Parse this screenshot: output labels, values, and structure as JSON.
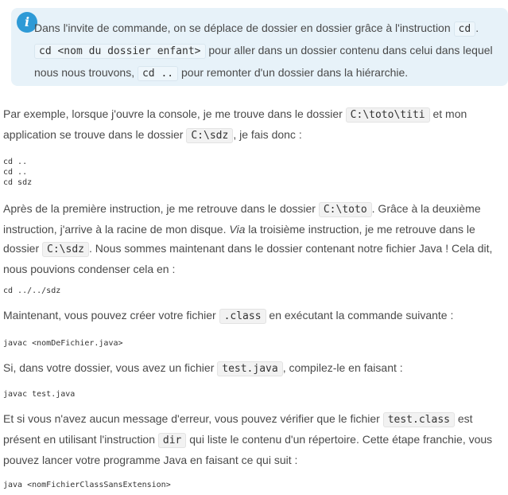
{
  "info": {
    "icon": "info-icon",
    "t1": "Dans l'invite de commande, on se déplace de dossier en dossier grâce à l'instruction ",
    "c1": "cd",
    "t2": ".",
    "c2": "cd <nom du dossier enfant>",
    "t3": " pour aller dans un dossier contenu dans celui dans lequel nous nous trouvons, ",
    "c3": "cd ..",
    "t4": " pour remonter d'un dossier dans la hiérarchie."
  },
  "p1": {
    "t1": "Par exemple, lorsque j'ouvre la console, je me trouve dans le dossier ",
    "c1": "C:\\toto\\titi",
    "t2": " et mon application se trouve dans le dossier ",
    "c2": "C:\\sdz",
    "t3": ", je fais donc :"
  },
  "code1": "cd ..\ncd ..\ncd sdz",
  "p2": {
    "t1": "Après de la première instruction, je me retrouve dans le dossier ",
    "c1": "C:\\toto",
    "t2": ". Grâce à la deuxième instruction, j'arrive à la racine de mon disque. ",
    "em": "Via",
    "t3": " la troisième instruction, je me retrouve dans le dossier ",
    "c2": "C:\\sdz",
    "t4": ". Nous sommes maintenant dans le dossier contenant notre fichier Java ! Cela dit, nous pouvions condenser cela en :"
  },
  "code2": "cd ../../sdz",
  "p3": {
    "t1": "Maintenant, vous pouvez créer votre fichier ",
    "c1": ".class",
    "t2": " en exécutant la commande suivante :"
  },
  "code3": "javac <nomDeFichier.java>",
  "p4": {
    "t1": "Si, dans votre dossier, vous avez un fichier ",
    "c1": "test.java",
    "t2": ", compilez-le en faisant :"
  },
  "code4": "javac test.java",
  "p5": {
    "t1": "Et si vous n'avez aucun message d'erreur, vous pouvez vérifier que le fichier ",
    "c1": "test.class",
    "t2": " est présent en utilisant l'instruction ",
    "c2": "dir",
    "t3": " qui liste le contenu d'un répertoire. Cette étape franchie, vous pouvez lancer votre programme Java en faisant ce qui suit :"
  },
  "code5": "java <nomFichierClassSansExtension>"
}
